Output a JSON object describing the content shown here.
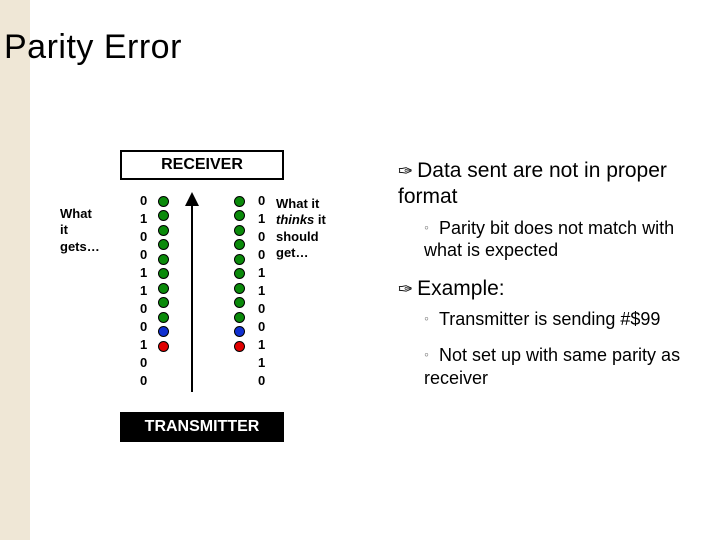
{
  "title": "Parity Error",
  "receiver_label": "RECEIVER",
  "transmitter_label": "TRANSMITTER",
  "left_label_l1": "What",
  "left_label_l2": "it",
  "left_label_l3": "gets…",
  "right_label_l1": "What it",
  "right_label_l2_a": "thinks",
  "right_label_l2_b": " it",
  "right_label_l3": "should",
  "right_label_l4": "get…",
  "bullets": {
    "b1": "Data sent are not in proper format",
    "b1s": "Parity bit does not match with what is expected",
    "b2": "Example:",
    "b2s1": "Transmitter is sending #$99",
    "b2s2": "Not set up with same parity as receiver"
  },
  "chart_data": {
    "type": "table",
    "title": "Parity Error bit streams",
    "columns": [
      "receiver_bits",
      "receiver_dot_color",
      "thinks_dot_color",
      "thinks_bits"
    ],
    "rows": [
      [
        "0",
        "green",
        "green",
        "0"
      ],
      [
        "1",
        "green",
        "green",
        "1"
      ],
      [
        "0",
        "green",
        "green",
        "0"
      ],
      [
        "0",
        "green",
        "green",
        "0"
      ],
      [
        "1",
        "green",
        "green",
        "1"
      ],
      [
        "1",
        "green",
        "green",
        "1"
      ],
      [
        "0",
        "green",
        "green",
        "0"
      ],
      [
        "0",
        "green",
        "green",
        "0"
      ],
      [
        "1",
        "green",
        "green",
        "1"
      ],
      [
        "0",
        "blue",
        "blue",
        "1"
      ],
      [
        "0",
        "red",
        "red",
        "0"
      ]
    ],
    "highlight_row_index_right": 9
  }
}
